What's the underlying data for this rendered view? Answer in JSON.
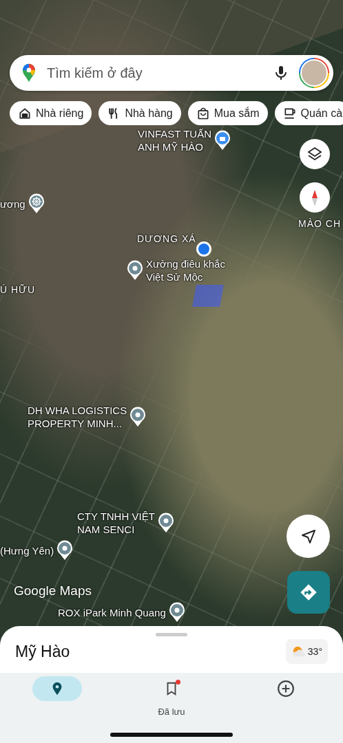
{
  "search": {
    "placeholder": "Tìm kiếm ở đây"
  },
  "chips": [
    {
      "label": "Nhà riêng",
      "kind": "home"
    },
    {
      "label": "Nhà hàng",
      "kind": "restaurant"
    },
    {
      "label": "Mua sắm",
      "kind": "shopping"
    },
    {
      "label": "Quán cà",
      "kind": "cafe"
    }
  ],
  "map_labels": [
    {
      "text": "VINFAST TUẤN\nANH MỸ HÀO",
      "kind": "shop"
    },
    {
      "text": "ương",
      "kind": "temple"
    },
    {
      "text": "MÀO CH",
      "kind": "area"
    },
    {
      "text": "DƯƠNG XÁ",
      "kind": "area"
    },
    {
      "text": "Xưởng điêu khắc\nViệt Sử Mộc",
      "kind": "place"
    },
    {
      "text": "Ú HỮU",
      "kind": "area"
    },
    {
      "text": "DH WHA LOGISTICS\nPROPERTY MINH...",
      "kind": "place"
    },
    {
      "text": "CTY TNHH VIỆT\nNAM SENCI",
      "kind": "place"
    },
    {
      "text": "(Hưng Yên)",
      "kind": "place"
    },
    {
      "text": "ROX iPark Minh Quang",
      "kind": "place"
    }
  ],
  "map_logo": "Google Maps",
  "sheet": {
    "title": "Mỹ Hào",
    "temperature": "33°"
  },
  "nav": [
    {
      "kind": "explore",
      "selected": true
    },
    {
      "kind": "saved",
      "label": "Đã lưu",
      "badge": true,
      "selected": false
    },
    {
      "kind": "contribute",
      "selected": false
    }
  ]
}
